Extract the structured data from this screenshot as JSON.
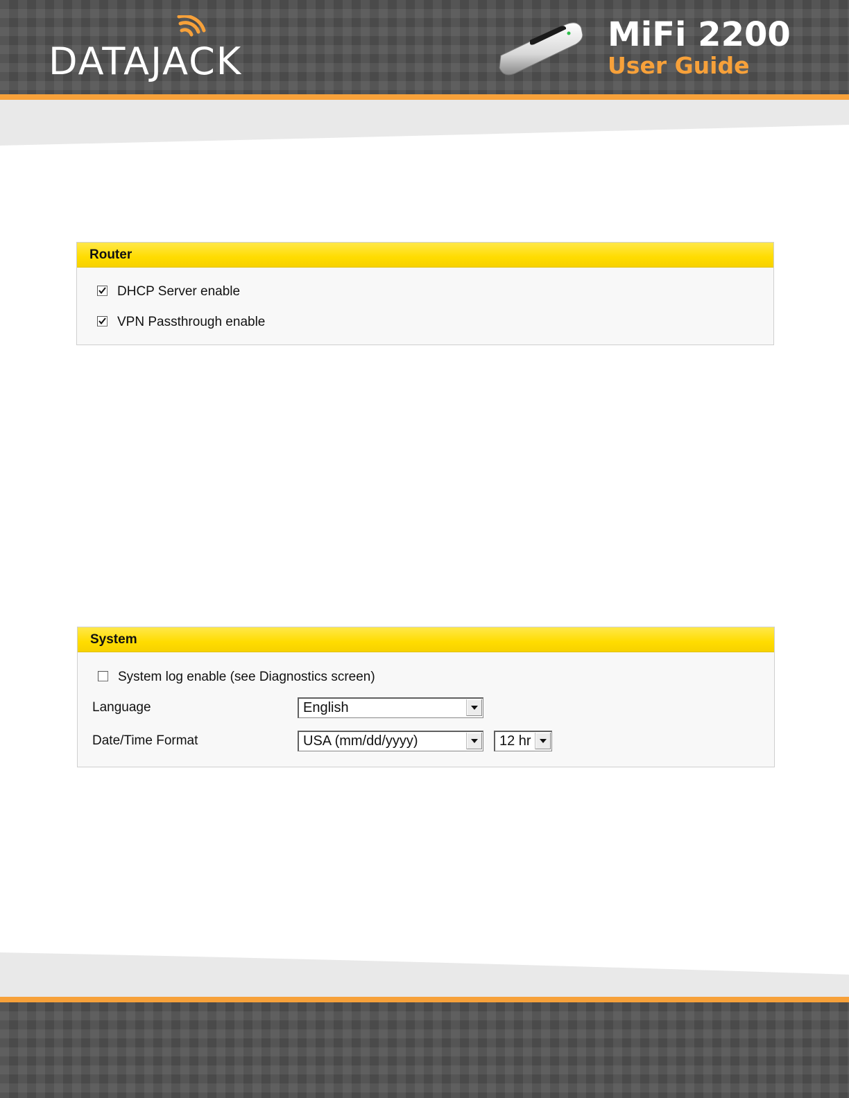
{
  "header": {
    "logo_text": "DATAJACK",
    "product_title": "MiFi 2200",
    "product_subtitle": "User Guide"
  },
  "router_panel": {
    "title": "Router",
    "options": [
      {
        "label": "DHCP Server enable",
        "checked": true
      },
      {
        "label": "VPN Passthrough enable",
        "checked": true
      }
    ]
  },
  "system_panel": {
    "title": "System",
    "syslog": {
      "label": "System log enable (see Diagnostics screen)",
      "checked": false
    },
    "language": {
      "label": "Language",
      "selected": "English"
    },
    "datetime": {
      "label": "Date/Time Format",
      "date_selected": "USA (mm/dd/yyyy)",
      "time_selected": "12 hr"
    }
  },
  "colors": {
    "accent_orange": "#f7a13a",
    "panel_header_yellow": "#ffdc00",
    "banner_gray": "#4a4a4a"
  }
}
